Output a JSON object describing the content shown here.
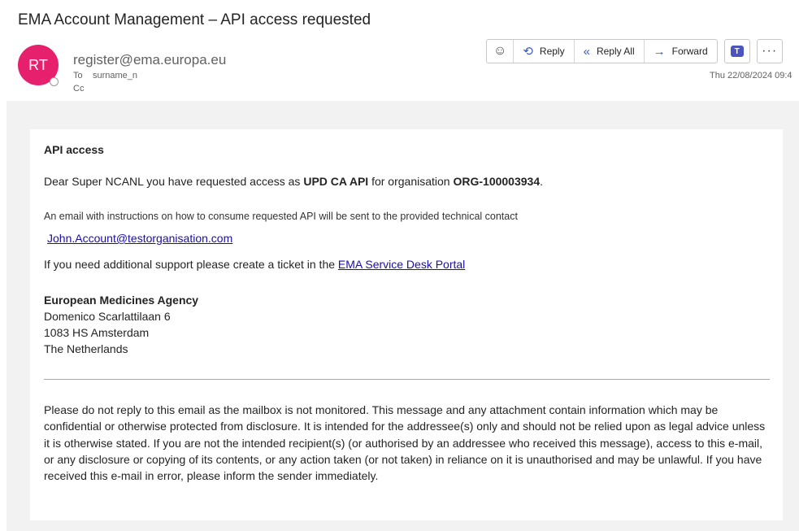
{
  "email": {
    "subject": "EMA Account Management – API access requested",
    "sender": {
      "initials": "RT",
      "address": "register@ema.europa.eu",
      "avatar_color": "#e6206d"
    },
    "to_label": "To",
    "to_value": "surname_n",
    "cc_label": "Cc",
    "timestamp": "Thu 22/08/2024 09:4"
  },
  "toolbar": {
    "emoji_icon": "smiley-icon",
    "reply_label": "Reply",
    "reply_all_label": "Reply All",
    "forward_label": "Forward",
    "teams_icon": "teams-icon",
    "more_icon": "more-icon"
  },
  "body": {
    "heading": "API access",
    "dear_prefix": "Dear Super NCANL you have requested access as ",
    "role": "UPD CA API",
    "org_prefix": " for organisation ",
    "org_id": "ORG-100003934",
    "org_suffix": ".",
    "email_info": "An email with instructions on how to consume requested API will be sent to the provided technical contact",
    "contact_email": "John.Account@testorganisation.com",
    "support_text": "If you need additional support please create a ticket in the ",
    "support_link": "EMA Service Desk Portal",
    "address": {
      "org": "European Medicines Agency",
      "street": "Domenico Scarlattilaan 6",
      "city": "1083 HS Amsterdam",
      "country": "The Netherlands"
    },
    "disclaimer": "Please do not reply to this email as the mailbox is not monitored. This message and any attachment contain information which may be confidential or otherwise protected from disclosure. It is intended for the addressee(s) only and should not be relied upon as legal advice unless it is otherwise stated. If you are not the intended recipient(s) (or authorised by an addressee who received this message), access to this e-mail, or any disclosure or copying of its contents, or any action taken (or not taken) in reliance on it is unauthorised and may be unlawful. If you have received this e-mail in error, please inform the sender immediately."
  }
}
